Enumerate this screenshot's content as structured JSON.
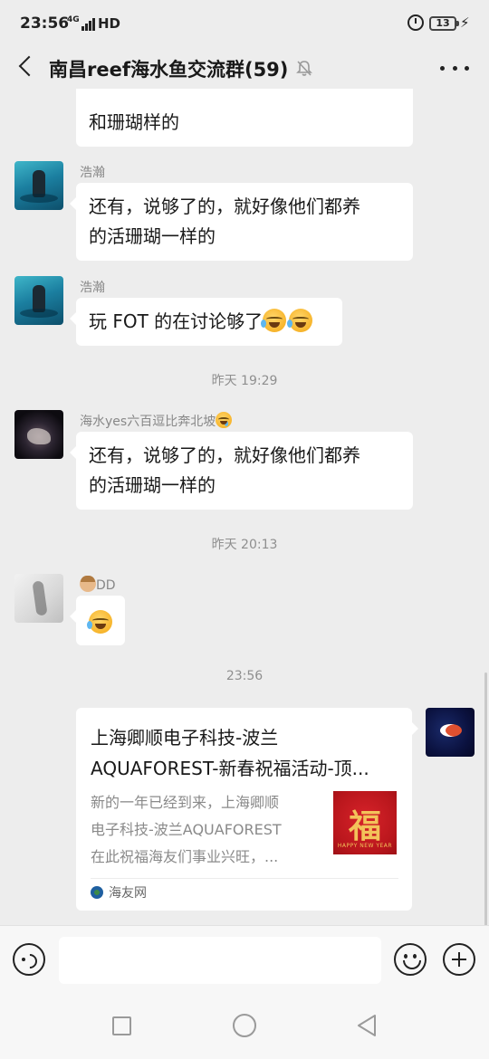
{
  "status_bar": {
    "time": "23:56",
    "network": "4G",
    "hd": "HD",
    "battery": "13"
  },
  "header": {
    "title": "南昌reef海水鱼交流群(59)",
    "muted": true
  },
  "messages": [
    {
      "type": "text",
      "partial_top": true,
      "visible_lines": [
        "和珊瑚样的"
      ]
    },
    {
      "type": "text",
      "sender": "浩瀚",
      "avatar": "diver-avatar",
      "text_lines": [
        "还有，说够了的，就好像他们都养",
        "的活珊瑚一样的"
      ]
    },
    {
      "type": "text",
      "sender": "浩瀚",
      "avatar": "diver-avatar",
      "text": "玩 FOT 的在讨论够了",
      "emojis": [
        "crying-laughing-emoji",
        "crying-laughing-emoji"
      ]
    },
    {
      "type": "timestamp",
      "text": "昨天 19:29"
    },
    {
      "type": "text",
      "sender": "海水yes六百逗比奔北坡",
      "sender_emoji": "crying-face-emoji",
      "avatar": "dark-avatar",
      "text_lines": [
        "还有，说够了的，就好像他们都养",
        "的活珊瑚一样的"
      ]
    },
    {
      "type": "timestamp",
      "text": "昨天 20:13"
    },
    {
      "type": "emoji",
      "sender": "DD",
      "sender_emoji": "face-emoji",
      "avatar": "shadow-avatar",
      "emoji": "crying-laughing-emoji"
    },
    {
      "type": "timestamp",
      "text": "23:56"
    },
    {
      "type": "link_card",
      "from_self": true,
      "avatar": "fish-avatar",
      "title_lines": [
        "上海卿顺电子科技-波兰",
        "AQUAFOREST-新春祝福活动-顶..."
      ],
      "desc_lines": [
        "新的一年已经到来，上海卿顺",
        "电子科技-波兰AQUAFOREST",
        "在此祝福海友们事业兴旺，..."
      ],
      "thumbnail_char": "福",
      "thumbnail_caption": "HAPPY NEW YEAR",
      "source": "海友网"
    }
  ],
  "input_bar": {
    "placeholder": ""
  },
  "colors": {
    "background": "#ededed",
    "bubble": "#ffffff",
    "thumbnail": "#d8232a"
  }
}
